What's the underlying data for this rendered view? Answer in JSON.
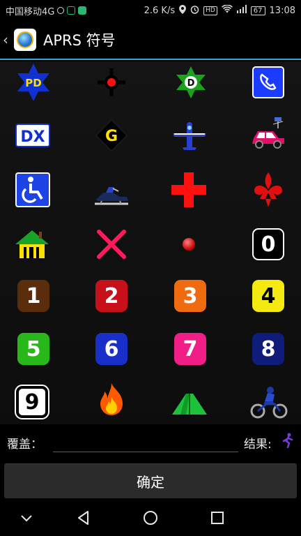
{
  "status": {
    "carrier": "中国移动4G",
    "speed": "2.6 K/s",
    "hd": "HD",
    "battery": "67",
    "time": "13:08"
  },
  "header": {
    "title": "APRS 符号"
  },
  "symbols": [
    {
      "name": "police-star-pd-icon",
      "label": "PD"
    },
    {
      "name": "red-dot-crosshair-icon"
    },
    {
      "name": "star-d-icon",
      "label": "D"
    },
    {
      "name": "telephone-icon"
    },
    {
      "name": "dx-icon",
      "label": "DX"
    },
    {
      "name": "gateway-diamond-icon",
      "label": "G"
    },
    {
      "name": "airplane-icon"
    },
    {
      "name": "car-with-satellite-icon"
    },
    {
      "name": "wheelchair-icon"
    },
    {
      "name": "snowmobile-icon"
    },
    {
      "name": "red-cross-icon"
    },
    {
      "name": "boy-scout-fleur-icon"
    },
    {
      "name": "house-icon"
    },
    {
      "name": "pink-x-icon"
    },
    {
      "name": "small-red-dot-icon"
    },
    {
      "name": "number-0-icon",
      "label": "0"
    },
    {
      "name": "number-1-icon",
      "label": "1"
    },
    {
      "name": "number-2-icon",
      "label": "2"
    },
    {
      "name": "number-3-icon",
      "label": "3"
    },
    {
      "name": "number-4-icon",
      "label": "4"
    },
    {
      "name": "number-5-icon",
      "label": "5"
    },
    {
      "name": "number-6-icon",
      "label": "6"
    },
    {
      "name": "number-7-icon",
      "label": "7"
    },
    {
      "name": "number-8-icon",
      "label": "8"
    },
    {
      "name": "number-9-icon",
      "label": "9"
    },
    {
      "name": "fire-icon"
    },
    {
      "name": "tent-icon"
    },
    {
      "name": "motorcycle-icon"
    }
  ],
  "form": {
    "coverage_label": "覆盖：",
    "coverage_value": "",
    "result_label": "结果:",
    "confirm_label": "确定"
  },
  "colors": {
    "accent_line": "#35a5d8",
    "num1": "#5a2e0c",
    "num2": "#c8101a",
    "num3": "#f06a10",
    "num4": "#f4ea10",
    "num5": "#28b81a",
    "num6": "#1830c8",
    "num7": "#f01e86",
    "num8": "#101c7a",
    "num9": "#ffffff",
    "num0": "#000000"
  }
}
